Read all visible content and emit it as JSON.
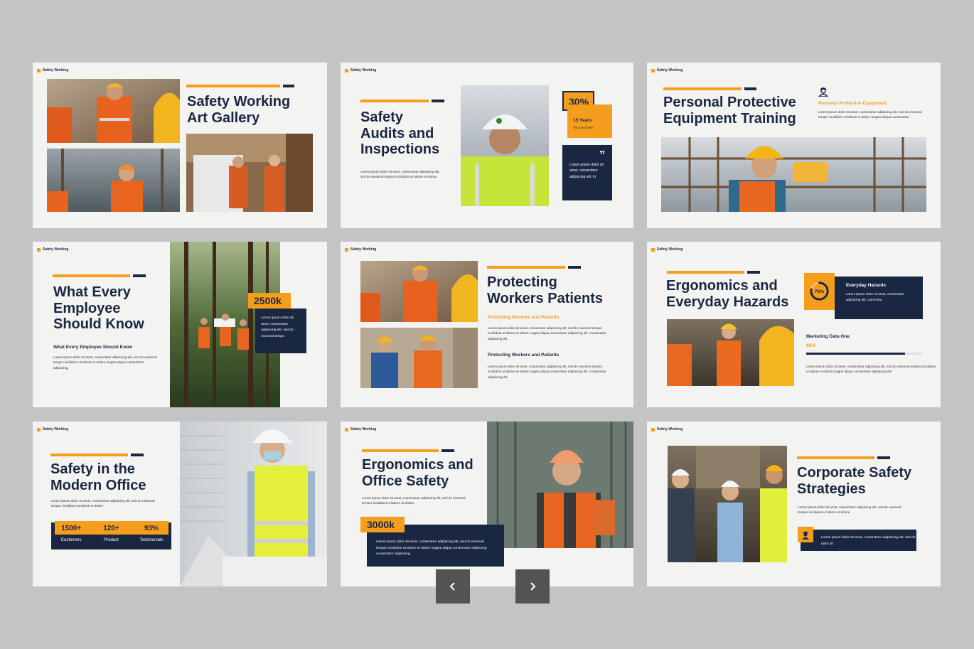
{
  "colors": {
    "accent": "#f59e1d",
    "navy": "#1a2742",
    "slide_bg": "#f3f3f2",
    "page_bg": "#c4c4c4"
  },
  "brand": "Safety Working",
  "lorem": {
    "short": "Lorem ipsum dolor sit amet, consectetur adipiscing elit, sed do eiusmod tempor incididunt ut labore et dolore.",
    "long": "Lorem ipsum dolor sit amet, consectetur adipiscing elit, sed do eiusmod tempor incididunt ut labore et dolore magna aliqua consectetur adipiscing elit.",
    "medium": "Lorem ipsum dolor sit amet, consectetur adipiscing elit, sed do eiusmod tempor incididunt ut labore et dolore magna aliqua consectetur.",
    "tiny": "Lorem ipsum dolor sit amet, consectetur adipiscing elit, sed do eiusmod tempor",
    "s6": "Lorem ipsum dolor sit amet, consectetur adipiscing elit, sed do eiusmod tempor incididunt ut labore et dolore magna aliqua consectetur adipiscing elit.",
    "s8": "Lorem ipsum dolor sit amet, consectetur adipiscing elit, sed do eiusmod tempor incididunt ut labore et dolore magna aliqua consectetur adipiscing consectetur adipiscing."
  },
  "slides": {
    "s1": {
      "title1": "Safety Working",
      "title2": "Art Gallery"
    },
    "s2": {
      "title1": "Safety",
      "title2": "Audits and",
      "title3": "Inspections",
      "body": "Lorem ipsum dolor sit amet, consectetur adipiscing elit, sed do eiusmod tempor incididunt ut labore et dolore.",
      "percent": "30%",
      "years": "15 Years",
      "caption": "Your text here",
      "quote_mark": "”",
      "quote": "Lorem ipsum dolor sit amet, consectetur adipiscing elit. In"
    },
    "s3": {
      "title1": "Personal Protective",
      "title2": "Equipment  Training",
      "sub": "Personal Protective Equipment",
      "body": "Lorem ipsum dolor sit amet, consectetur adipiscing elit, sed do eiusmod tempor incididunt ut labore et dolore magna aliqua consectetur."
    },
    "s4": {
      "title1": "What Every",
      "title2": "Employee",
      "title3": "Should Know",
      "sub": "What Every Employee Should Know",
      "body": "Lorem ipsum dolor sit amet, consectetur adipiscing elit, sed do eiusmod tempor incididunt ut labore et dolore magna aliqua consectetur adipiscing.",
      "stat": "2500k",
      "stat_body": "Lorem ipsum dolor sit amet, consectetur adipiscing elit, sed do eiusmod tempo"
    },
    "s5": {
      "title1": "Protecting",
      "title2": "Workers Patients",
      "osub": "Protecting Workers and Patients",
      "body1": "Lorem ipsum dolor sit amet, consectetur adipiscing elit, sed do eiusmod tempor incididunt ut labore et dolore magna aliqua consectetur adipiscing elit. consectetur adipiscing elit.",
      "sub2": "Protecting Workers and Patients",
      "body2": "Lorem ipsum dolor sit amet, consectetur adipiscing elit, sed do eiusmod tempor incididunt ut labore et dolore magna aliqua consectetur adipiscing elit. consectetur adipiscing elit."
    },
    "s6": {
      "title1": "Ergonomics and",
      "title2": "Everyday Hazards",
      "ring_value": 0.78,
      "ring_label": "78%",
      "card_title": "Everyday Hazards",
      "card_body": "Lorem ipsum dolor sit amet, consectetur adipiscing elit, commodo.",
      "metric_label": "Marketing Data One",
      "metric_value": 0.85,
      "metric_text": "85%",
      "body": "Lorem ipsum dolor sit amet, consectetur adipiscing elit, sed do eiusmod tempor incididunt ut labore et dolore magna aliqua consectetur adipiscing elit."
    },
    "s7": {
      "title1": "Safety in the",
      "title2": "Modern Office",
      "body": "Lorem ipsum dolor sit amet, consectetur adipiscing elit, sed do eiusmod tempor incididunt ut labore et dolore",
      "stats": [
        {
          "value": "1500+",
          "label": "Customers"
        },
        {
          "value": "120+",
          "label": "Product"
        },
        {
          "value": "93%",
          "label": "Testimonials"
        }
      ]
    },
    "s8": {
      "title1": "Ergonomics and",
      "title2": "Office Safety",
      "body": "Lorem ipsum dolor sit amet, consectetur adipiscing elit, sed do eiusmod tempor incididunt ut labore et dolore.",
      "stat": "3000k",
      "card_body": "Lorem ipsum dolor sit amet, consectetur adipiscing elit, sed do eiusmod tempor incididunt ut labore et dolore magna aliqua consectetur adipiscing consectetur adipiscing."
    },
    "s9": {
      "title1": "Corporate Safety",
      "title2": "Strategies",
      "body": "Lorem ipsum dolor sit amet, consectetur adipiscing elit, sed do eiusmod tempor incididunt ut labore et dolore",
      "card_body": "Lorem ipsum dolor sit amet, consectetur adipiscing elit, sed do dolor sit"
    }
  },
  "nav": {
    "prev_icon": "chevron-left-icon",
    "next_icon": "chevron-right-icon"
  }
}
